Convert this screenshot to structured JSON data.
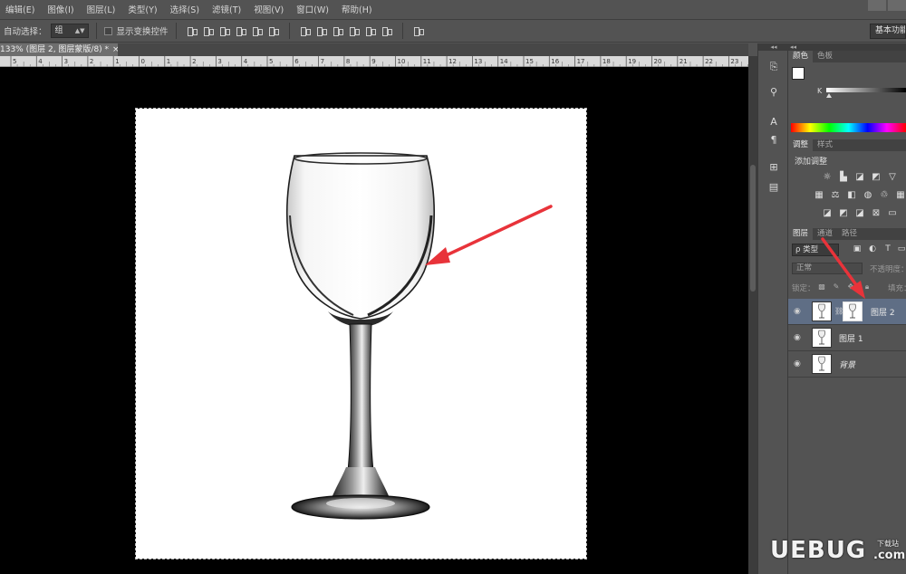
{
  "menu": [
    "编辑(E)",
    "图像(I)",
    "图层(L)",
    "类型(Y)",
    "选择(S)",
    "滤镜(T)",
    "视图(V)",
    "窗口(W)",
    "帮助(H)"
  ],
  "options": {
    "auto_select_label": "自动选择：",
    "auto_select_value": "组",
    "show_transform_label": "显示变换控件",
    "workspace_label": "基本功能"
  },
  "document_tab": {
    "title": "133% (图层 2, 图层蒙版/8) *",
    "close": "×"
  },
  "ruler_ticks": [
    "5",
    "4",
    "3",
    "2",
    "1",
    "0",
    "1",
    "2",
    "3",
    "4",
    "5",
    "6",
    "7",
    "8",
    "9",
    "10",
    "11",
    "12",
    "13",
    "14",
    "15",
    "16",
    "17",
    "18",
    "19",
    "20",
    "21",
    "22",
    "23"
  ],
  "color_panel": {
    "tabs": [
      "颜色",
      "色板"
    ],
    "slider_label": "K",
    "k_value": 0
  },
  "adjust_panel": {
    "tabs": [
      "调整",
      "样式"
    ],
    "title": "添加调整",
    "row1_icons": [
      "brightness-icon",
      "levels-icon",
      "curves-icon",
      "exposure-icon",
      "vibrance-triangle-icon"
    ],
    "row2_icons": [
      "hsl-icon",
      "color-balance-icon",
      "black-white-icon",
      "photo-filter-icon",
      "channel-mixer-icon",
      "color-lookup-icon"
    ],
    "row3_icons": [
      "invert-icon",
      "posterize-icon",
      "threshold-icon",
      "selective-color-icon",
      "gradient-map-icon"
    ]
  },
  "layers_panel": {
    "tabs": [
      "图层",
      "通道",
      "路径"
    ],
    "filter_label": "ρ 类型",
    "blend_mode": "正常",
    "opacity_label": "不透明度：",
    "lock_label": "锁定：",
    "fill_label": "填充：",
    "layers": [
      {
        "name": "图层 2",
        "selected": true,
        "has_mask": true
      },
      {
        "name": "图层 1",
        "selected": false,
        "has_mask": false
      },
      {
        "name": "背景",
        "selected": false,
        "has_mask": false
      }
    ]
  },
  "watermark": {
    "main": "UEBUG",
    "dot": ".com",
    "top": "下载站"
  },
  "colors": {
    "ui_bg": "#535353",
    "canvas_bg": "#000000",
    "selected_layer": "#5f6e85",
    "annotation_arrow": "#e8333a"
  }
}
